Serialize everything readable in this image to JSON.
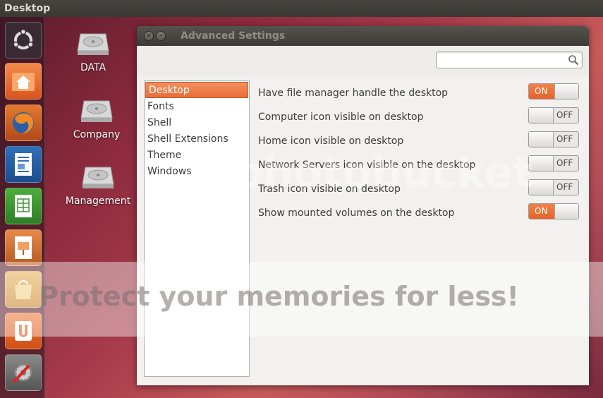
{
  "panel": {
    "title": "Desktop"
  },
  "launcher": {
    "items": [
      {
        "icon": "ubuntu-logo-icon"
      },
      {
        "icon": "home-folder-icon"
      },
      {
        "icon": "firefox-icon"
      },
      {
        "icon": "writer-icon"
      },
      {
        "icon": "calc-icon"
      },
      {
        "icon": "impress-icon"
      },
      {
        "icon": "software-center-icon"
      },
      {
        "icon": "ubuntu-one-icon"
      },
      {
        "icon": "system-settings-icon"
      }
    ]
  },
  "desktop": {
    "icons": [
      {
        "label": "DATA"
      },
      {
        "label": "Company"
      },
      {
        "label": "Management"
      }
    ]
  },
  "window": {
    "title": "Advanced Settings",
    "search": {
      "value": "",
      "placeholder": ""
    },
    "sidebar": {
      "items": [
        {
          "label": "Desktop",
          "selected": true
        },
        {
          "label": "Fonts"
        },
        {
          "label": "Shell"
        },
        {
          "label": "Shell Extensions"
        },
        {
          "label": "Theme"
        },
        {
          "label": "Windows"
        }
      ]
    },
    "settings": [
      {
        "label": "Have file manager handle the desktop",
        "state": "ON"
      },
      {
        "label": "Computer icon visible on desktop",
        "state": "OFF"
      },
      {
        "label": "Home icon visible on desktop",
        "state": "OFF"
      },
      {
        "label": "Network Servers icon visible on the desktop",
        "state": "OFF"
      },
      {
        "label": "Trash icon visible on desktop",
        "state": "OFF"
      },
      {
        "label": "Show mounted volumes on the desktop",
        "state": "ON"
      }
    ]
  },
  "watermark": {
    "logo": "photobucket",
    "text": "Protect your memories for less!"
  },
  "colors": {
    "accent": "#e96d36",
    "panel": "#3c3b37"
  }
}
